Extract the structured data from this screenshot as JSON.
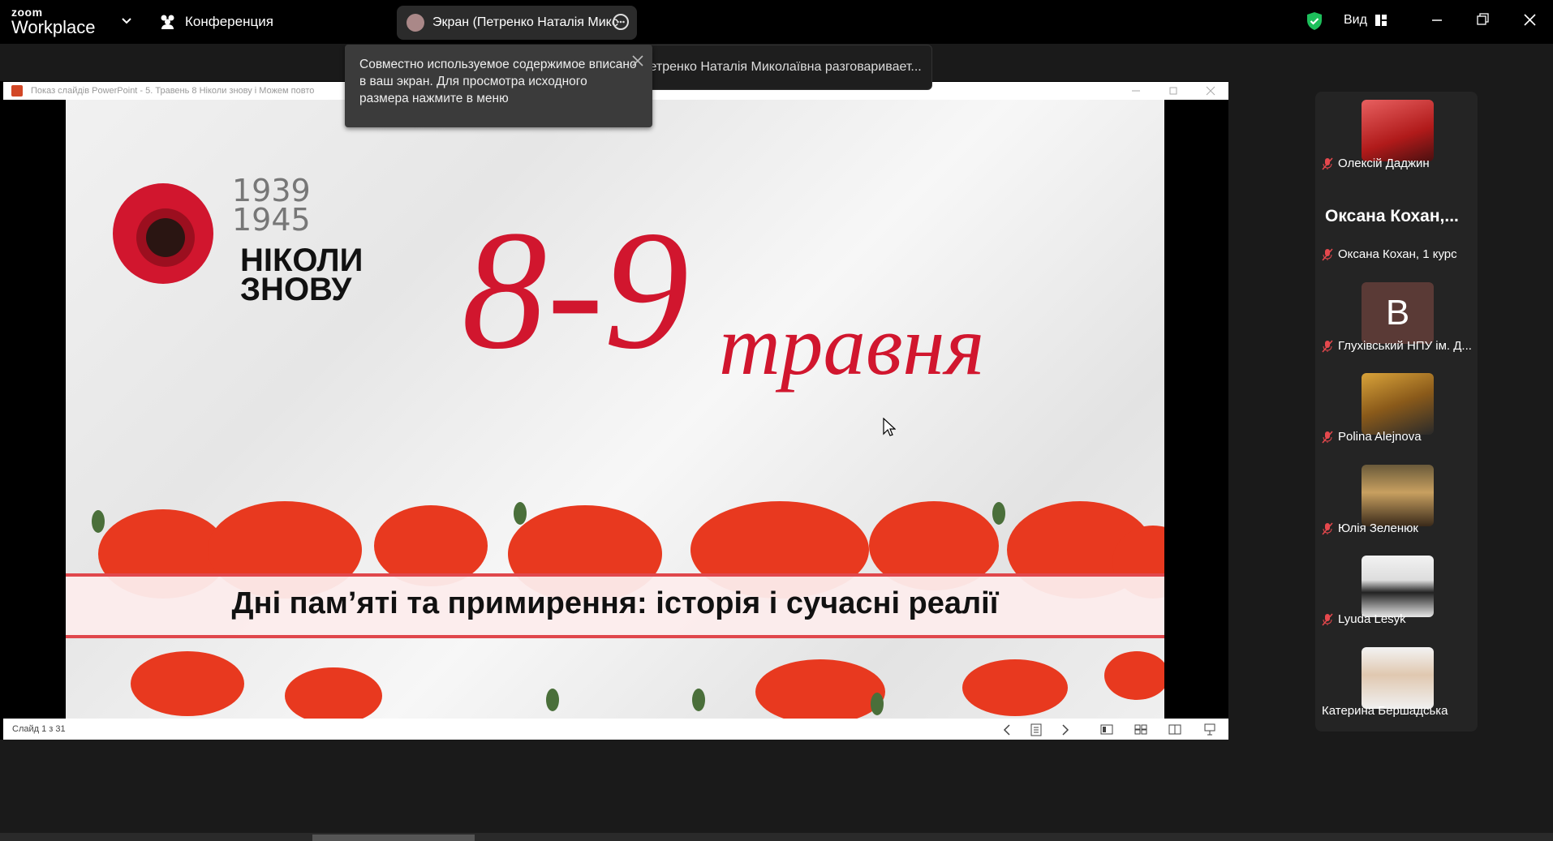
{
  "app": {
    "logo_small": "zoom",
    "logo_big": "Workplace"
  },
  "header": {
    "meeting_label": "Конференция",
    "share_label": "Экран (Петренко Наталія Микс",
    "view_label": "Вид"
  },
  "tooltip": {
    "text": "Совместно используемое содержимое вписано в ваш экран. Для просмотра исходного размера нажмите в меню"
  },
  "speaking": {
    "text": "Петренко Наталія Миколаївна разговаривает..."
  },
  "powerpoint": {
    "title": "Показ слайдів PowerPoint  -  5. Травень 8 Ніколи знову і Можем повто",
    "status": "Слайд 1 з 31"
  },
  "slide": {
    "year_start": "1939",
    "year_end": "1945",
    "never_line1": "НІКОЛИ",
    "never_line2": "ЗНОВУ",
    "dates": "8-9",
    "month": "травня",
    "subtitle": "Дні пам’яті та примирення: історія і сучасні реалії"
  },
  "participants": [
    {
      "name": "Олексій Даджин"
    },
    {
      "name": "Оксана Кохан, 1 курс",
      "big": "Оксана  Кохан,..."
    },
    {
      "name": "Глухівський НПУ ім. Д...",
      "initial": "B"
    },
    {
      "name": "Polina Alejnova"
    },
    {
      "name": "Юлія Зеленюк"
    },
    {
      "name": "Lyuda Lesyk"
    },
    {
      "name": "Катерина Бершадська"
    }
  ],
  "colors": {
    "accent": "#d1162e",
    "muted": "#e5484d",
    "secure": "#1dbf5b"
  }
}
